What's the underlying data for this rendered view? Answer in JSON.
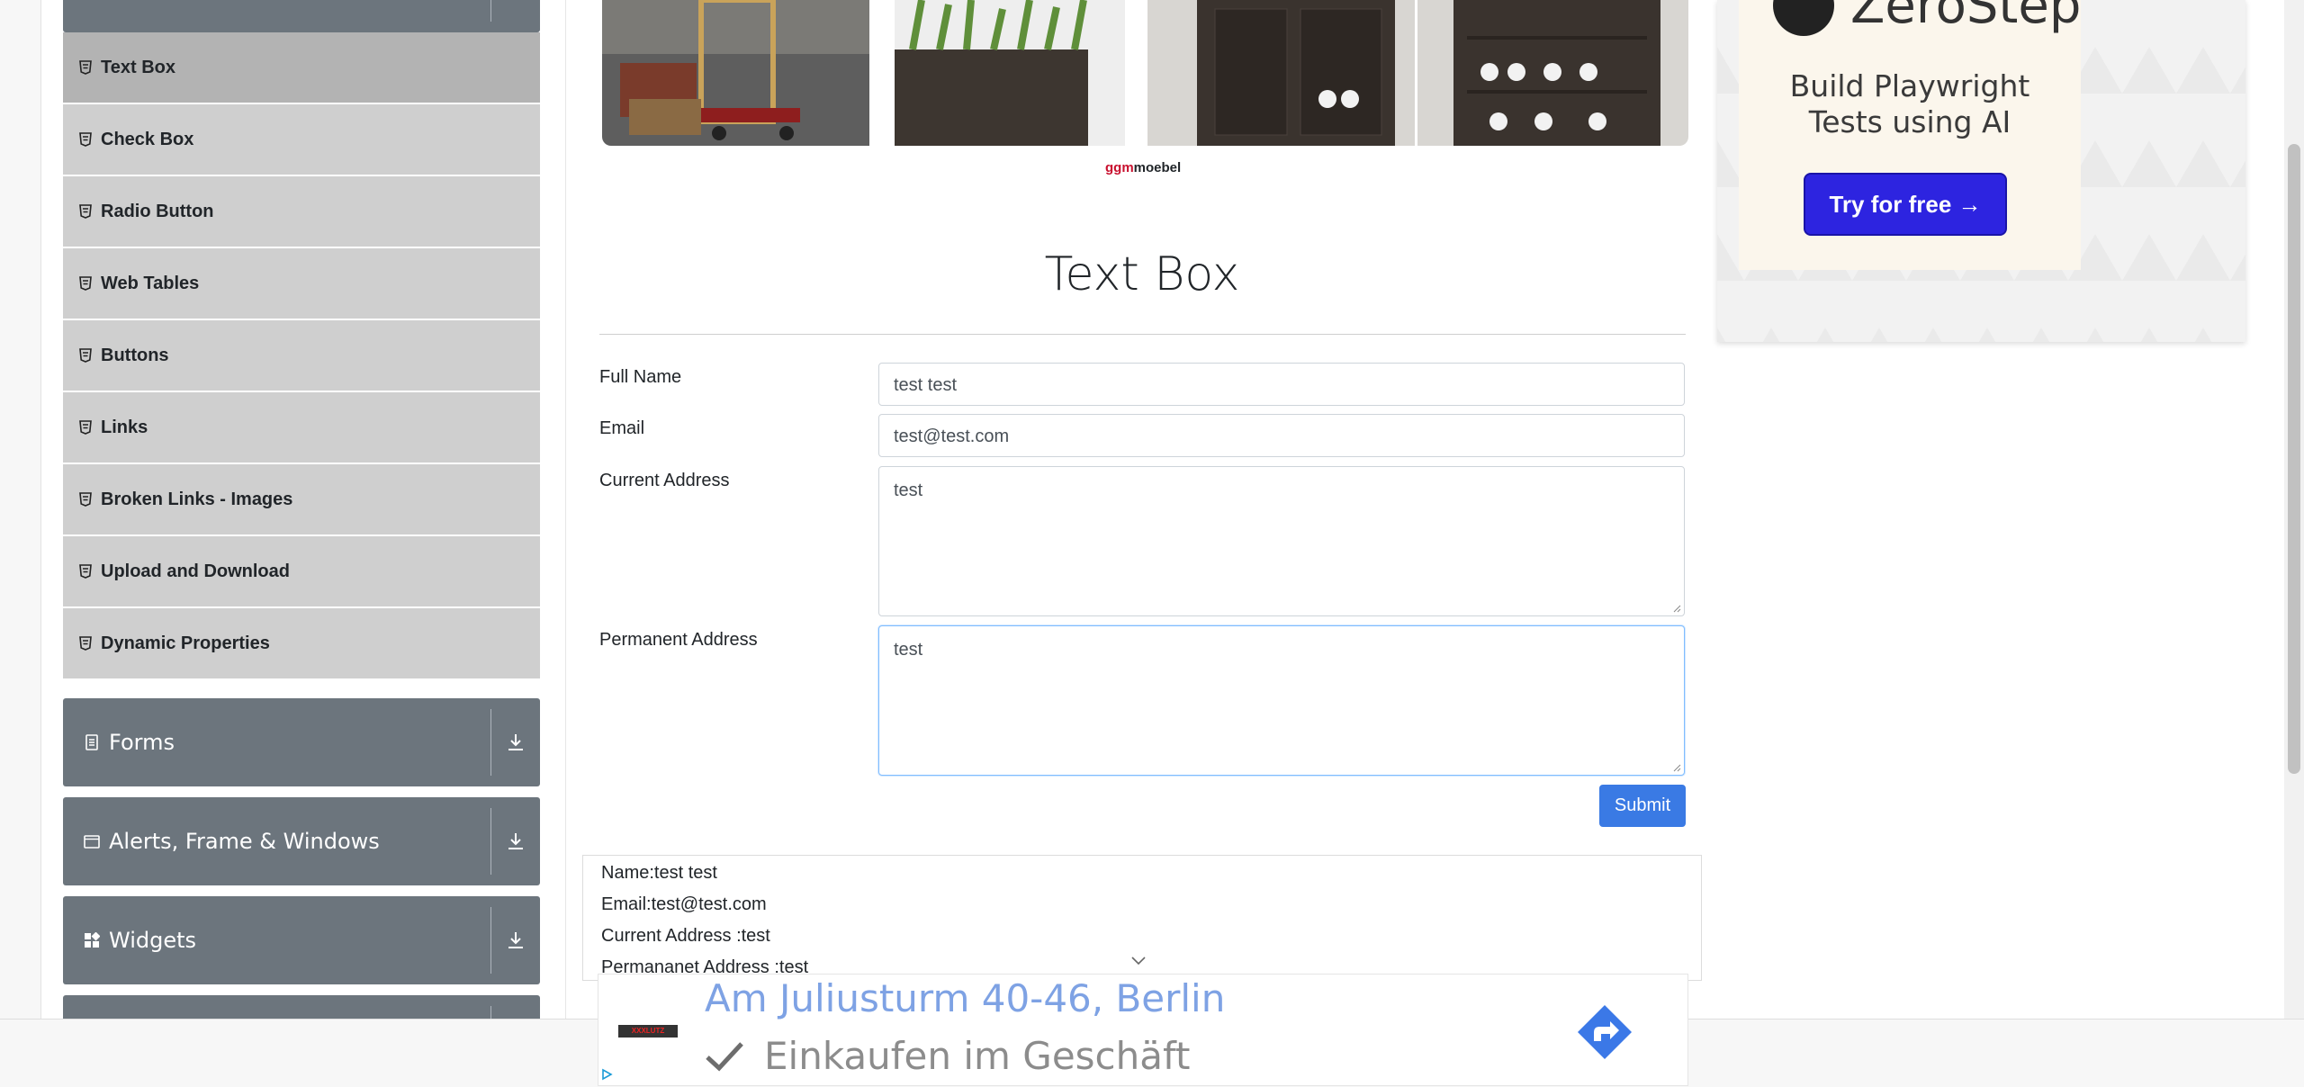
{
  "sidebar": {
    "items": [
      {
        "label": "Text Box",
        "active": true
      },
      {
        "label": "Check Box"
      },
      {
        "label": "Radio Button"
      },
      {
        "label": "Web Tables"
      },
      {
        "label": "Buttons"
      },
      {
        "label": "Links"
      },
      {
        "label": "Broken Links - Images"
      },
      {
        "label": "Upload and Download"
      },
      {
        "label": "Dynamic Properties"
      }
    ],
    "groups": [
      {
        "label": "Forms",
        "icon": "form-icon"
      },
      {
        "label": "Alerts, Frame & Windows",
        "icon": "window-icon"
      },
      {
        "label": "Widgets",
        "icon": "widgets-icon"
      }
    ]
  },
  "banner": {
    "brand_red": "ggm",
    "brand_black": "moebel"
  },
  "page": {
    "title": "Text Box"
  },
  "form": {
    "fullname": {
      "label": "Full Name",
      "value": "test test"
    },
    "email": {
      "label": "Email",
      "value": "test@test.com"
    },
    "current_address": {
      "label": "Current Address",
      "value": "test"
    },
    "permanent_address": {
      "label": "Permanent Address",
      "value": "test"
    },
    "submit_label": "Submit"
  },
  "output": {
    "name": "Name:test test",
    "email": "Email:test@test.com",
    "current": "Current Address :test",
    "permanent": "Permananet Address :test"
  },
  "ad_zerostep": {
    "brand": "ZeroStep",
    "headline_1": "Build Playwright",
    "headline_2": "Tests using AI",
    "cta": "Try for free →"
  },
  "ad_bottom": {
    "logo": "XXXLUTZ",
    "address": "Am Juliusturm 40-46, Berlin",
    "tagline": "Einkaufen im Geschäft"
  },
  "colors": {
    "sidebar_group": "#6c757d",
    "sidebar_item": "#cfcfcf",
    "sidebar_item_active": "#b3b3b3",
    "submit": "#3a7ae4",
    "ad_cta": "#2d24e0"
  }
}
